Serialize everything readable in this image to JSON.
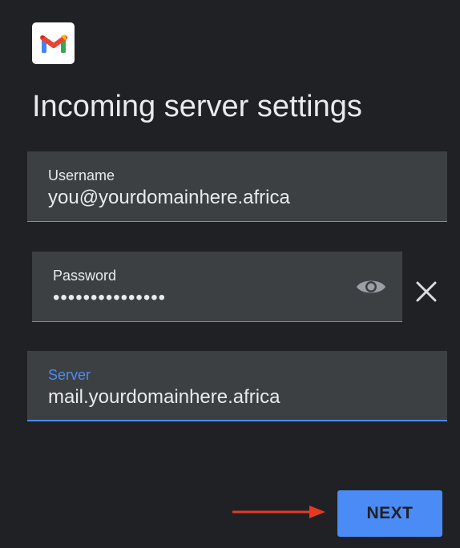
{
  "header": {
    "logo_icon": "gmail-logo-icon",
    "title": "Incoming server settings"
  },
  "form": {
    "username": {
      "label": "Username",
      "value": "you@yourdomainhere.africa"
    },
    "password": {
      "label": "Password",
      "value": "•••••••••••••••",
      "toggle_icon": "eye-icon",
      "clear_icon": "close-icon"
    },
    "server": {
      "label": "Server",
      "value": "mail.yourdomainhere.africa",
      "focused": true
    }
  },
  "actions": {
    "next_label": "NEXT"
  },
  "annotation": {
    "arrow_icon": "arrow-right-icon",
    "arrow_color": "#e53923"
  },
  "colors": {
    "background": "#202124",
    "field_background": "#3c4043",
    "accent": "#4b8bf5",
    "text": "#e8eaed"
  }
}
